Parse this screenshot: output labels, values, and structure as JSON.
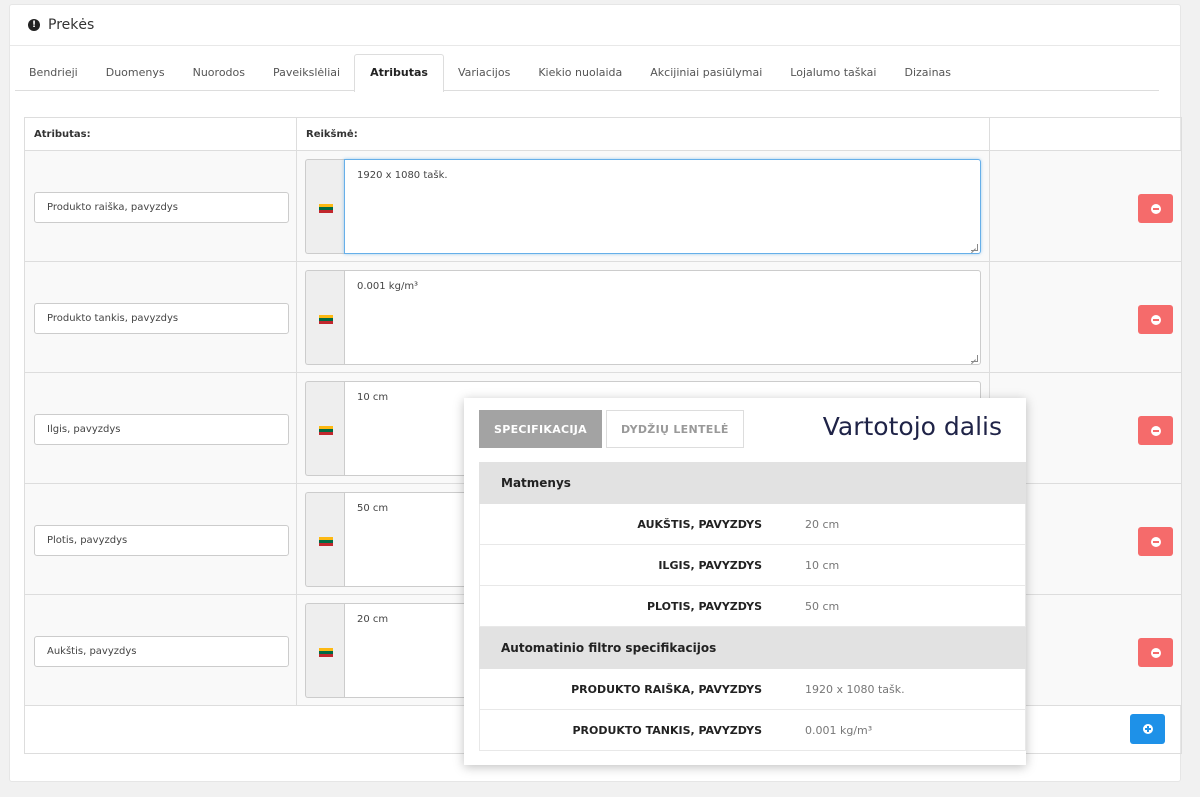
{
  "panel": {
    "title": "Prekės"
  },
  "tabs": [
    "Bendrieji",
    "Duomenys",
    "Nuorodos",
    "Paveikslėliai",
    "Atributas",
    "Variacijos",
    "Kiekio nuolaida",
    "Akcijiniai pasiūlymai",
    "Lojalumo taškai",
    "Dizainas"
  ],
  "active_tab": "Atributas",
  "table": {
    "header_attr": "Atributas:",
    "header_value": "Reikšmė:",
    "rows": [
      {
        "attribute": "Produkto raiška, pavyzdys",
        "value": "1920 x 1080 tašk."
      },
      {
        "attribute": "Produkto tankis, pavyzdys",
        "value": "0.001 kg/m³"
      },
      {
        "attribute": "Ilgis, pavyzdys",
        "value": "10 cm"
      },
      {
        "attribute": "Plotis, pavyzdys",
        "value": "50 cm"
      },
      {
        "attribute": "Aukštis, pavyzdys",
        "value": "20 cm"
      }
    ]
  },
  "overlay": {
    "tab_active": "SPECIFIKACIJA",
    "tab_inactive": "DYDŽIŲ LENTELĖ",
    "title": "Vartotojo dalis",
    "sections": [
      {
        "heading": "Matmenys",
        "rows": [
          {
            "key": "AUKŠTIS, PAVYZDYS",
            "value": "20 cm"
          },
          {
            "key": "ILGIS, PAVYZDYS",
            "value": "10 cm"
          },
          {
            "key": "PLOTIS, PAVYZDYS",
            "value": "50 cm"
          }
        ]
      },
      {
        "heading": "Automatinio filtro specifikacijos",
        "rows": [
          {
            "key": "PRODUKTO RAIŠKA, PAVYZDYS",
            "value": "1920 x 1080 tašk."
          },
          {
            "key": "PRODUKTO TANKIS, PAVYZDYS",
            "value": "0.001 kg/m³"
          }
        ]
      }
    ]
  },
  "colors": {
    "remove_button": "#f56b6b",
    "add_button": "#1e91e8",
    "focus_border": "#66afe9"
  },
  "icons": {
    "heading": "exclamation-circle-icon",
    "flag": "lithuania-flag-icon",
    "remove": "minus-circle-icon",
    "add": "plus-circle-icon"
  }
}
